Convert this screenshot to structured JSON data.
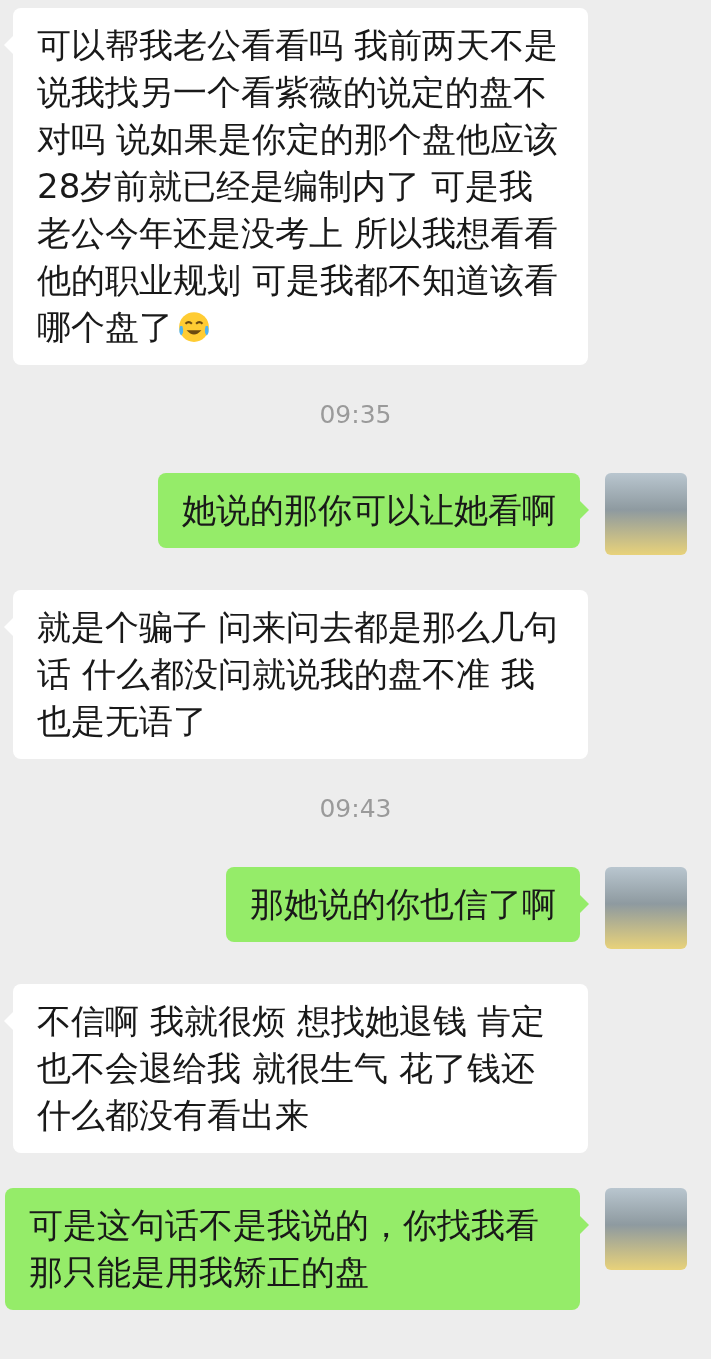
{
  "messages": [
    {
      "kind": "incoming",
      "text": "可以帮我老公看看吗 我前两天不是说我找另一个看紫薇的说定的盘不对吗 说如果是你定的那个盘他应该28岁前就已经是编制内了 可是我老公今年还是没考上 所以我想看看他的职业规划 可是我都不知道该看哪个盘了",
      "emoji": true
    },
    {
      "kind": "time",
      "text": "09:35"
    },
    {
      "kind": "outgoing",
      "text": "她说的那你可以让她看啊"
    },
    {
      "kind": "incoming",
      "text": "就是个骗子 问来问去都是那么几句话 什么都没问就说我的盘不准 我也是无语了",
      "emoji": false
    },
    {
      "kind": "time",
      "text": "09:43"
    },
    {
      "kind": "outgoing",
      "text": "那她说的你也信了啊"
    },
    {
      "kind": "incoming",
      "text": "不信啊 我就很烦 想找她退钱 肯定也不会退给我 就很生气 花了钱还什么都没有看出来",
      "emoji": false
    },
    {
      "kind": "outgoing",
      "text": "可是这句话不是我说的，你找我看那只能是用我矫正的盘"
    }
  ]
}
